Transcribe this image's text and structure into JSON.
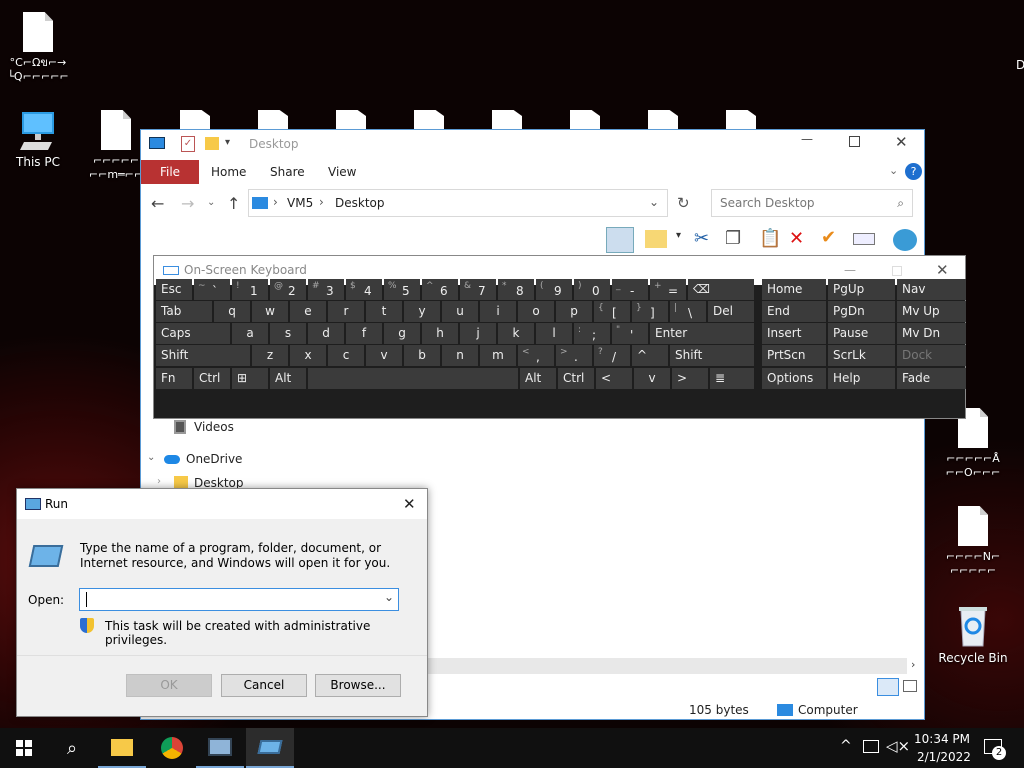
{
  "desktop": {
    "icons": [
      {
        "label": "°C⌐Ωข⌐→ └Q⌐⌐⌐⌐⌐",
        "kind": "file"
      },
      {
        "label": "This PC",
        "kind": "pc"
      },
      {
        "label": "⌐⌐⌐⌐⌐ ⌐⌐m═⌐⌐",
        "kind": "file"
      },
      {
        "label": "⌐⌐⌐⌐⌐Å ⌐⌐O⌐⌐⌐",
        "kind": "file"
      },
      {
        "label": "⌐⌐⌐⌐N⌐ ⌐⌐⌐⌐⌐",
        "kind": "file"
      },
      {
        "label": "Recycle Bin",
        "kind": "bin"
      }
    ],
    "edge_letter": "D"
  },
  "explorer": {
    "title": "Desktop",
    "tabs": [
      "File",
      "Home",
      "Share",
      "View"
    ],
    "path": [
      "VM5",
      "Desktop"
    ],
    "search_placeholder": "Search Desktop",
    "nav_items": [
      "Videos",
      "OneDrive",
      "Desktop"
    ],
    "status_size": "105 bytes",
    "status_location": "Computer"
  },
  "osk": {
    "title": "On-Screen Keyboard",
    "rows": [
      [
        "Esc",
        "~ `",
        "! 1",
        "@ 2",
        "# 3",
        "$ 4",
        "% 5",
        "^ 6",
        "& 7",
        "* 8",
        "( 9",
        ") 0",
        "_ -",
        "+ =",
        "⌫"
      ],
      [
        "Tab",
        "q",
        "w",
        "e",
        "r",
        "t",
        "y",
        "u",
        "i",
        "o",
        "p",
        "{ [",
        "} ]",
        "| \\",
        "Del"
      ],
      [
        "Caps",
        "a",
        "s",
        "d",
        "f",
        "g",
        "h",
        "j",
        "k",
        "l",
        ": ;",
        "\" '",
        "Enter"
      ],
      [
        "Shift",
        "z",
        "x",
        "c",
        "v",
        "b",
        "n",
        "m",
        "< ,",
        "> .",
        "? /",
        "^",
        "Shift"
      ],
      [
        "Fn",
        "Ctrl",
        "⊞",
        "Alt",
        "",
        "Alt",
        "Ctrl",
        "<",
        "v",
        ">",
        "≣"
      ]
    ],
    "nav_keys": [
      [
        "Home",
        "PgUp",
        "Nav"
      ],
      [
        "End",
        "PgDn",
        "Mv Up"
      ],
      [
        "Insert",
        "Pause",
        "Mv Dn"
      ],
      [
        "PrtScn",
        "ScrLk",
        "Dock"
      ],
      [
        "Options",
        "Help",
        "Fade"
      ]
    ]
  },
  "run": {
    "title": "Run",
    "description": "Type the name of a program, folder, document, or Internet resource, and Windows will open it for you.",
    "open_label": "Open:",
    "input_value": "",
    "admin_note": "This task will be created with administrative privileges.",
    "buttons": {
      "ok": "OK",
      "cancel": "Cancel",
      "browse": "Browse..."
    }
  },
  "taskbar": {
    "time": "10:34 PM",
    "date": "2/1/2022",
    "notifications": "2"
  },
  "colors": {
    "accent": "#0078d7",
    "file_tab": "#b83232"
  }
}
